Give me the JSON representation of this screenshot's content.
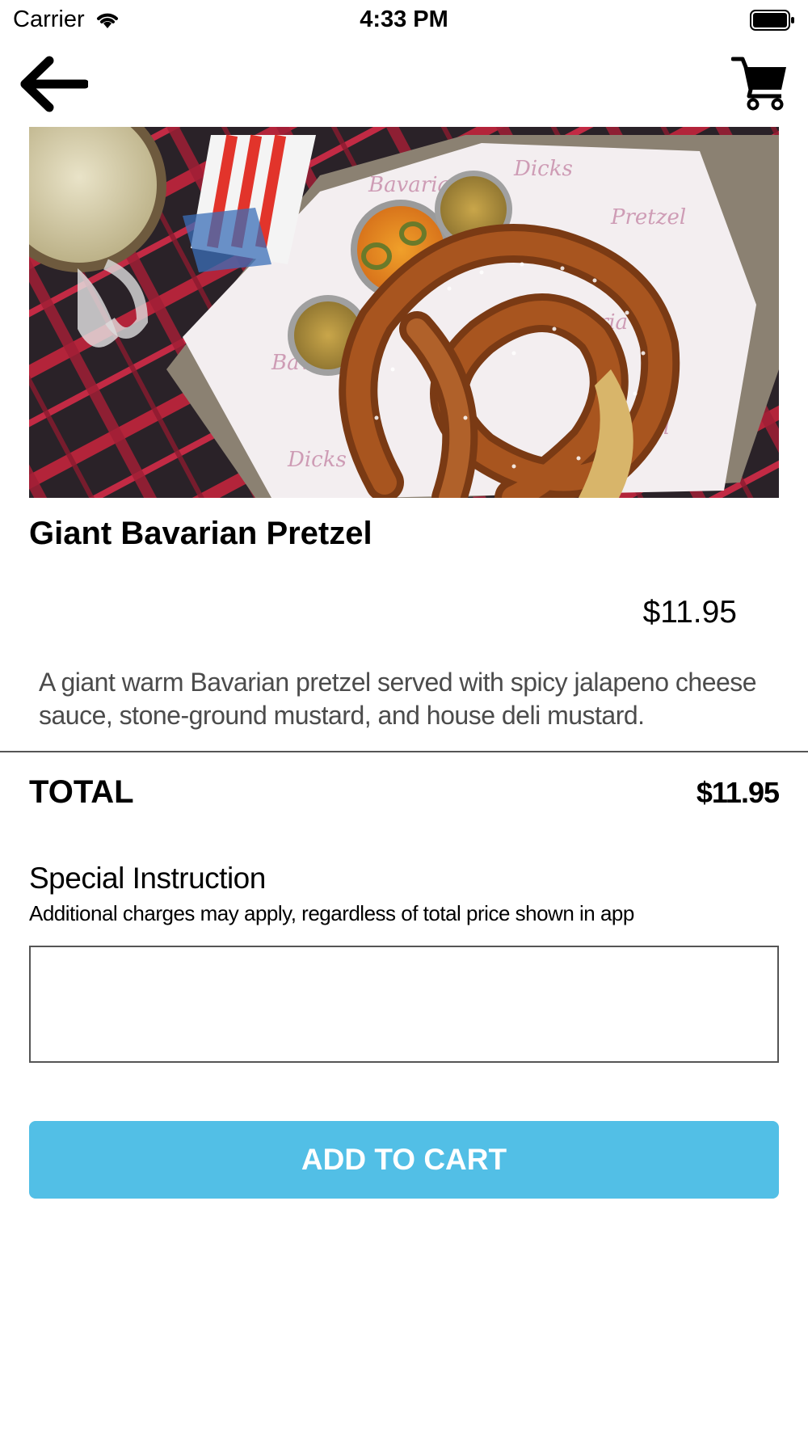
{
  "status_bar": {
    "carrier": "Carrier",
    "time": "4:33 PM",
    "icons": [
      "wifi-icon",
      "battery-icon"
    ]
  },
  "nav": {
    "back_icon": "arrow-left-icon",
    "cart_icon": "shopping-cart-icon"
  },
  "product": {
    "image": "pretzel-photo",
    "title": "Giant Bavarian Pretzel",
    "price": "$11.95",
    "description": "A giant warm Bavarian pretzel served with spicy jalapeno cheese sauce, stone-ground mustard, and house deli mustard."
  },
  "total": {
    "label": "TOTAL",
    "value": "$11.95"
  },
  "special_instruction": {
    "title": "Special Instruction",
    "note": "Additional charges may apply, regardless of total price shown in app",
    "value": "",
    "placeholder": ""
  },
  "actions": {
    "add_to_cart_label": "ADD TO CART"
  },
  "colors": {
    "accent": "#52bfe6",
    "divider": "#555555",
    "description_text": "#4b4b4b"
  }
}
